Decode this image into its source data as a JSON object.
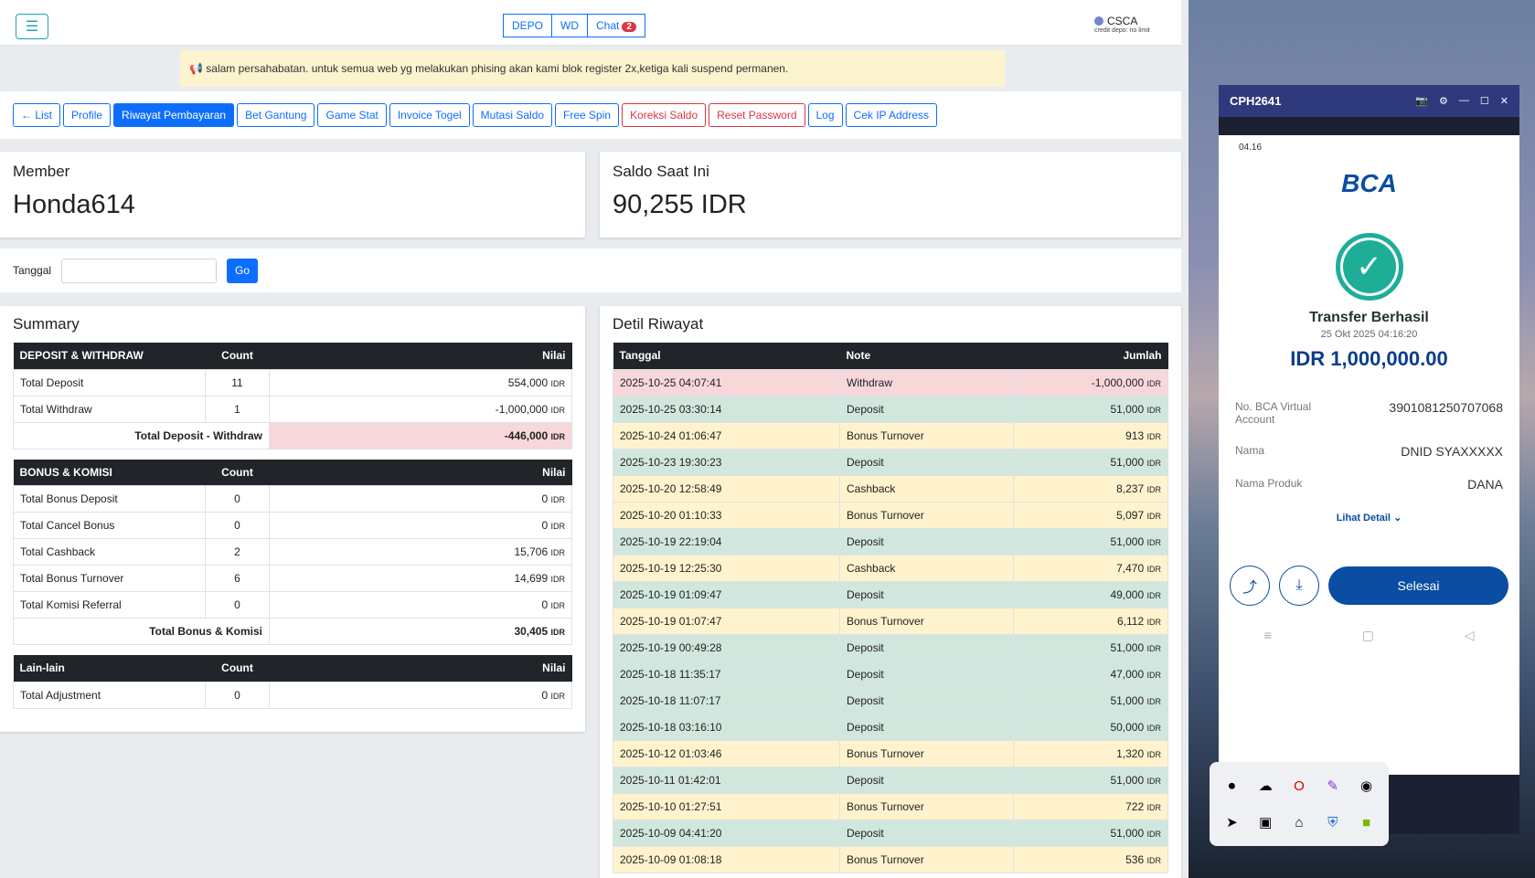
{
  "topbar": {
    "menu_icon": "hamburger-icon",
    "btn_depo": "DEPO",
    "btn_wd": "WD",
    "btn_chat": "Chat",
    "chat_badge": "2",
    "user": "CSCA",
    "user_sub": "credit depo: no limit"
  },
  "notice": "salam persahabatan. untuk semua web yg melakukan phising akan kami blok register 2x,ketiga kali suspend permanen.",
  "nav": [
    "← List",
    "Profile",
    "Riwayat Pembayaran",
    "Bet Gantung",
    "Game Stat",
    "Invoice Togel",
    "Mutasi Saldo",
    "Free Spin",
    "Koreksi Saldo",
    "Reset Password",
    "Log",
    "Cek IP Address"
  ],
  "member": {
    "label": "Member",
    "value": "Honda614"
  },
  "saldo": {
    "label": "Saldo Saat Ini",
    "value": "90,255 IDR"
  },
  "filter": {
    "label": "Tanggal",
    "go": "Go"
  },
  "summary": {
    "title": "Summary",
    "col_count": "Count",
    "col_nilai": "Nilai",
    "idr": "IDR",
    "dw": {
      "head": "DEPOSIT & WITHDRAW",
      "rows": [
        [
          "Total Deposit",
          "11",
          "554,000"
        ],
        [
          "Total Withdraw",
          "1",
          "-1,000,000"
        ]
      ],
      "total_label": "Total Deposit - Withdraw",
      "total": "-446,000"
    },
    "bk": {
      "head": "BONUS & KOMISI",
      "rows": [
        [
          "Total Bonus Deposit",
          "0",
          "0"
        ],
        [
          "Total Cancel Bonus",
          "0",
          "0"
        ],
        [
          "Total Cashback",
          "2",
          "15,706"
        ],
        [
          "Total Bonus Turnover",
          "6",
          "14,699"
        ],
        [
          "Total Komisi Referral",
          "0",
          "0"
        ]
      ],
      "total_label": "Total Bonus & Komisi",
      "total": "30,405"
    },
    "ll": {
      "head": "Lain-lain",
      "rows": [
        [
          "Total Adjustment",
          "0",
          "0"
        ]
      ]
    }
  },
  "detail": {
    "title": "Detil Riwayat",
    "col_tanggal": "Tanggal",
    "col_note": "Note",
    "col_jumlah": "Jumlah",
    "rows": [
      [
        "2025-10-25 04:07:41",
        "Withdraw",
        "-1,000,000",
        "pink"
      ],
      [
        "2025-10-25 03:30:14",
        "Deposit",
        "51,000",
        "green"
      ],
      [
        "2025-10-24 01:06:47",
        "Bonus Turnover",
        "913",
        "yellow"
      ],
      [
        "2025-10-23 19:30:23",
        "Deposit",
        "51,000",
        "green"
      ],
      [
        "2025-10-20 12:58:49",
        "Cashback",
        "8,237",
        "yellow"
      ],
      [
        "2025-10-20 01:10:33",
        "Bonus Turnover",
        "5,097",
        "yellow"
      ],
      [
        "2025-10-19 22:19:04",
        "Deposit",
        "51,000",
        "green"
      ],
      [
        "2025-10-19 12:25:30",
        "Cashback",
        "7,470",
        "yellow"
      ],
      [
        "2025-10-19 01:09:47",
        "Deposit",
        "49,000",
        "green"
      ],
      [
        "2025-10-19 01:07:47",
        "Bonus Turnover",
        "6,112",
        "yellow"
      ],
      [
        "2025-10-19 00:49:28",
        "Deposit",
        "51,000",
        "green"
      ],
      [
        "2025-10-18 11:35:17",
        "Deposit",
        "47,000",
        "green"
      ],
      [
        "2025-10-18 11:07:17",
        "Deposit",
        "51,000",
        "green"
      ],
      [
        "2025-10-18 03:16:10",
        "Deposit",
        "50,000",
        "green"
      ],
      [
        "2025-10-12 01:03:46",
        "Bonus Turnover",
        "1,320",
        "yellow"
      ],
      [
        "2025-10-11 01:42:01",
        "Deposit",
        "51,000",
        "green"
      ],
      [
        "2025-10-10 01:27:51",
        "Bonus Turnover",
        "722",
        "yellow"
      ],
      [
        "2025-10-09 04:41:20",
        "Deposit",
        "51,000",
        "green"
      ],
      [
        "2025-10-09 01:08:18",
        "Bonus Turnover",
        "536",
        "yellow"
      ]
    ]
  },
  "phone": {
    "title": "CPH2641",
    "time": "04.16",
    "brand": "BCA",
    "status_title": "Transfer Berhasil",
    "date": "25 Okt 2025 04:16:20",
    "amount": "IDR 1,000,000.00",
    "va_label": "No. BCA Virtual Account",
    "va_value": "3901081250707068",
    "nama_label": "Nama",
    "nama_value": "DNID SYAXXXXX",
    "produk_label": "Nama Produk",
    "produk_value": "DANA",
    "lihat": "Lihat Detail",
    "selesai": "Selesai"
  }
}
